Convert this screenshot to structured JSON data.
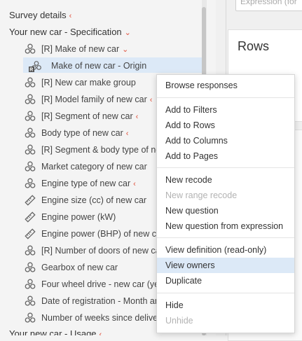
{
  "tree": {
    "sections": [
      {
        "label": "Survey details",
        "chevron": "‹"
      },
      {
        "label": "Your new car - Specification",
        "chevron": "⌄"
      },
      {
        "label": "Your new car - Usage",
        "chevron": "‹"
      }
    ],
    "items": [
      {
        "label": "[R] Make of new car",
        "icon": "variable-set-icon",
        "chevron": "⌄"
      },
      {
        "label": "Make of new car - Origin",
        "icon": "recode-icon",
        "chevron": ""
      },
      {
        "label": "[R] New car make group",
        "icon": "variable-set-icon",
        "chevron": ""
      },
      {
        "label": "[R] Model family of new car",
        "icon": "variable-set-icon",
        "chevron": "‹"
      },
      {
        "label": "[R] Segment of new car",
        "icon": "variable-set-icon",
        "chevron": "‹"
      },
      {
        "label": "Body type of new car",
        "icon": "variable-set-icon",
        "chevron": "‹"
      },
      {
        "label": "[R] Segment & body type of new car",
        "icon": "variable-set-icon",
        "chevron": ""
      },
      {
        "label": "Market category of new car",
        "icon": "variable-set-icon",
        "chevron": ""
      },
      {
        "label": "Engine type of new car",
        "icon": "variable-set-icon",
        "chevron": "‹"
      },
      {
        "label": "Engine size (cc) of new car",
        "icon": "ruler-icon",
        "chevron": ""
      },
      {
        "label": "Engine power (kW)",
        "icon": "ruler-icon",
        "chevron": ""
      },
      {
        "label": "Engine power (BHP) of new car",
        "icon": "ruler-icon",
        "chevron": ""
      },
      {
        "label": "[R] Number of doors of new car",
        "icon": "variable-set-icon",
        "chevron": ""
      },
      {
        "label": "Gearbox of new car",
        "icon": "variable-set-icon",
        "chevron": ""
      },
      {
        "label": "Four wheel drive - new car (yes/no)",
        "icon": "variable-set-icon",
        "chevron": ""
      },
      {
        "label": "Date of registration - Month and year",
        "icon": "variable-set-icon",
        "chevron": ""
      },
      {
        "label": "Number of weeks since delivery",
        "icon": "variable-set-icon",
        "chevron": ""
      }
    ]
  },
  "right": {
    "expression_placeholder": "Expression (for",
    "rows_title": "Rows"
  },
  "menu": {
    "items": [
      {
        "label": "Browse responses",
        "state": "normal"
      },
      {
        "label": "Add to Filters",
        "state": "normal"
      },
      {
        "label": "Add to Rows",
        "state": "normal"
      },
      {
        "label": "Add to Columns",
        "state": "normal"
      },
      {
        "label": "Add to Pages",
        "state": "normal"
      },
      {
        "label": "New recode",
        "state": "normal"
      },
      {
        "label": "New range recode",
        "state": "disabled"
      },
      {
        "label": "New question",
        "state": "normal"
      },
      {
        "label": "New question from expression",
        "state": "normal"
      },
      {
        "label": "View definition (read-only)",
        "state": "normal"
      },
      {
        "label": "View owners",
        "state": "hover"
      },
      {
        "label": "Duplicate",
        "state": "normal"
      },
      {
        "label": "Hide",
        "state": "normal"
      },
      {
        "label": "Unhide",
        "state": "disabled"
      }
    ]
  },
  "colors": {
    "accent_chevron": "#e0503c",
    "selection": "#dce9f7"
  }
}
